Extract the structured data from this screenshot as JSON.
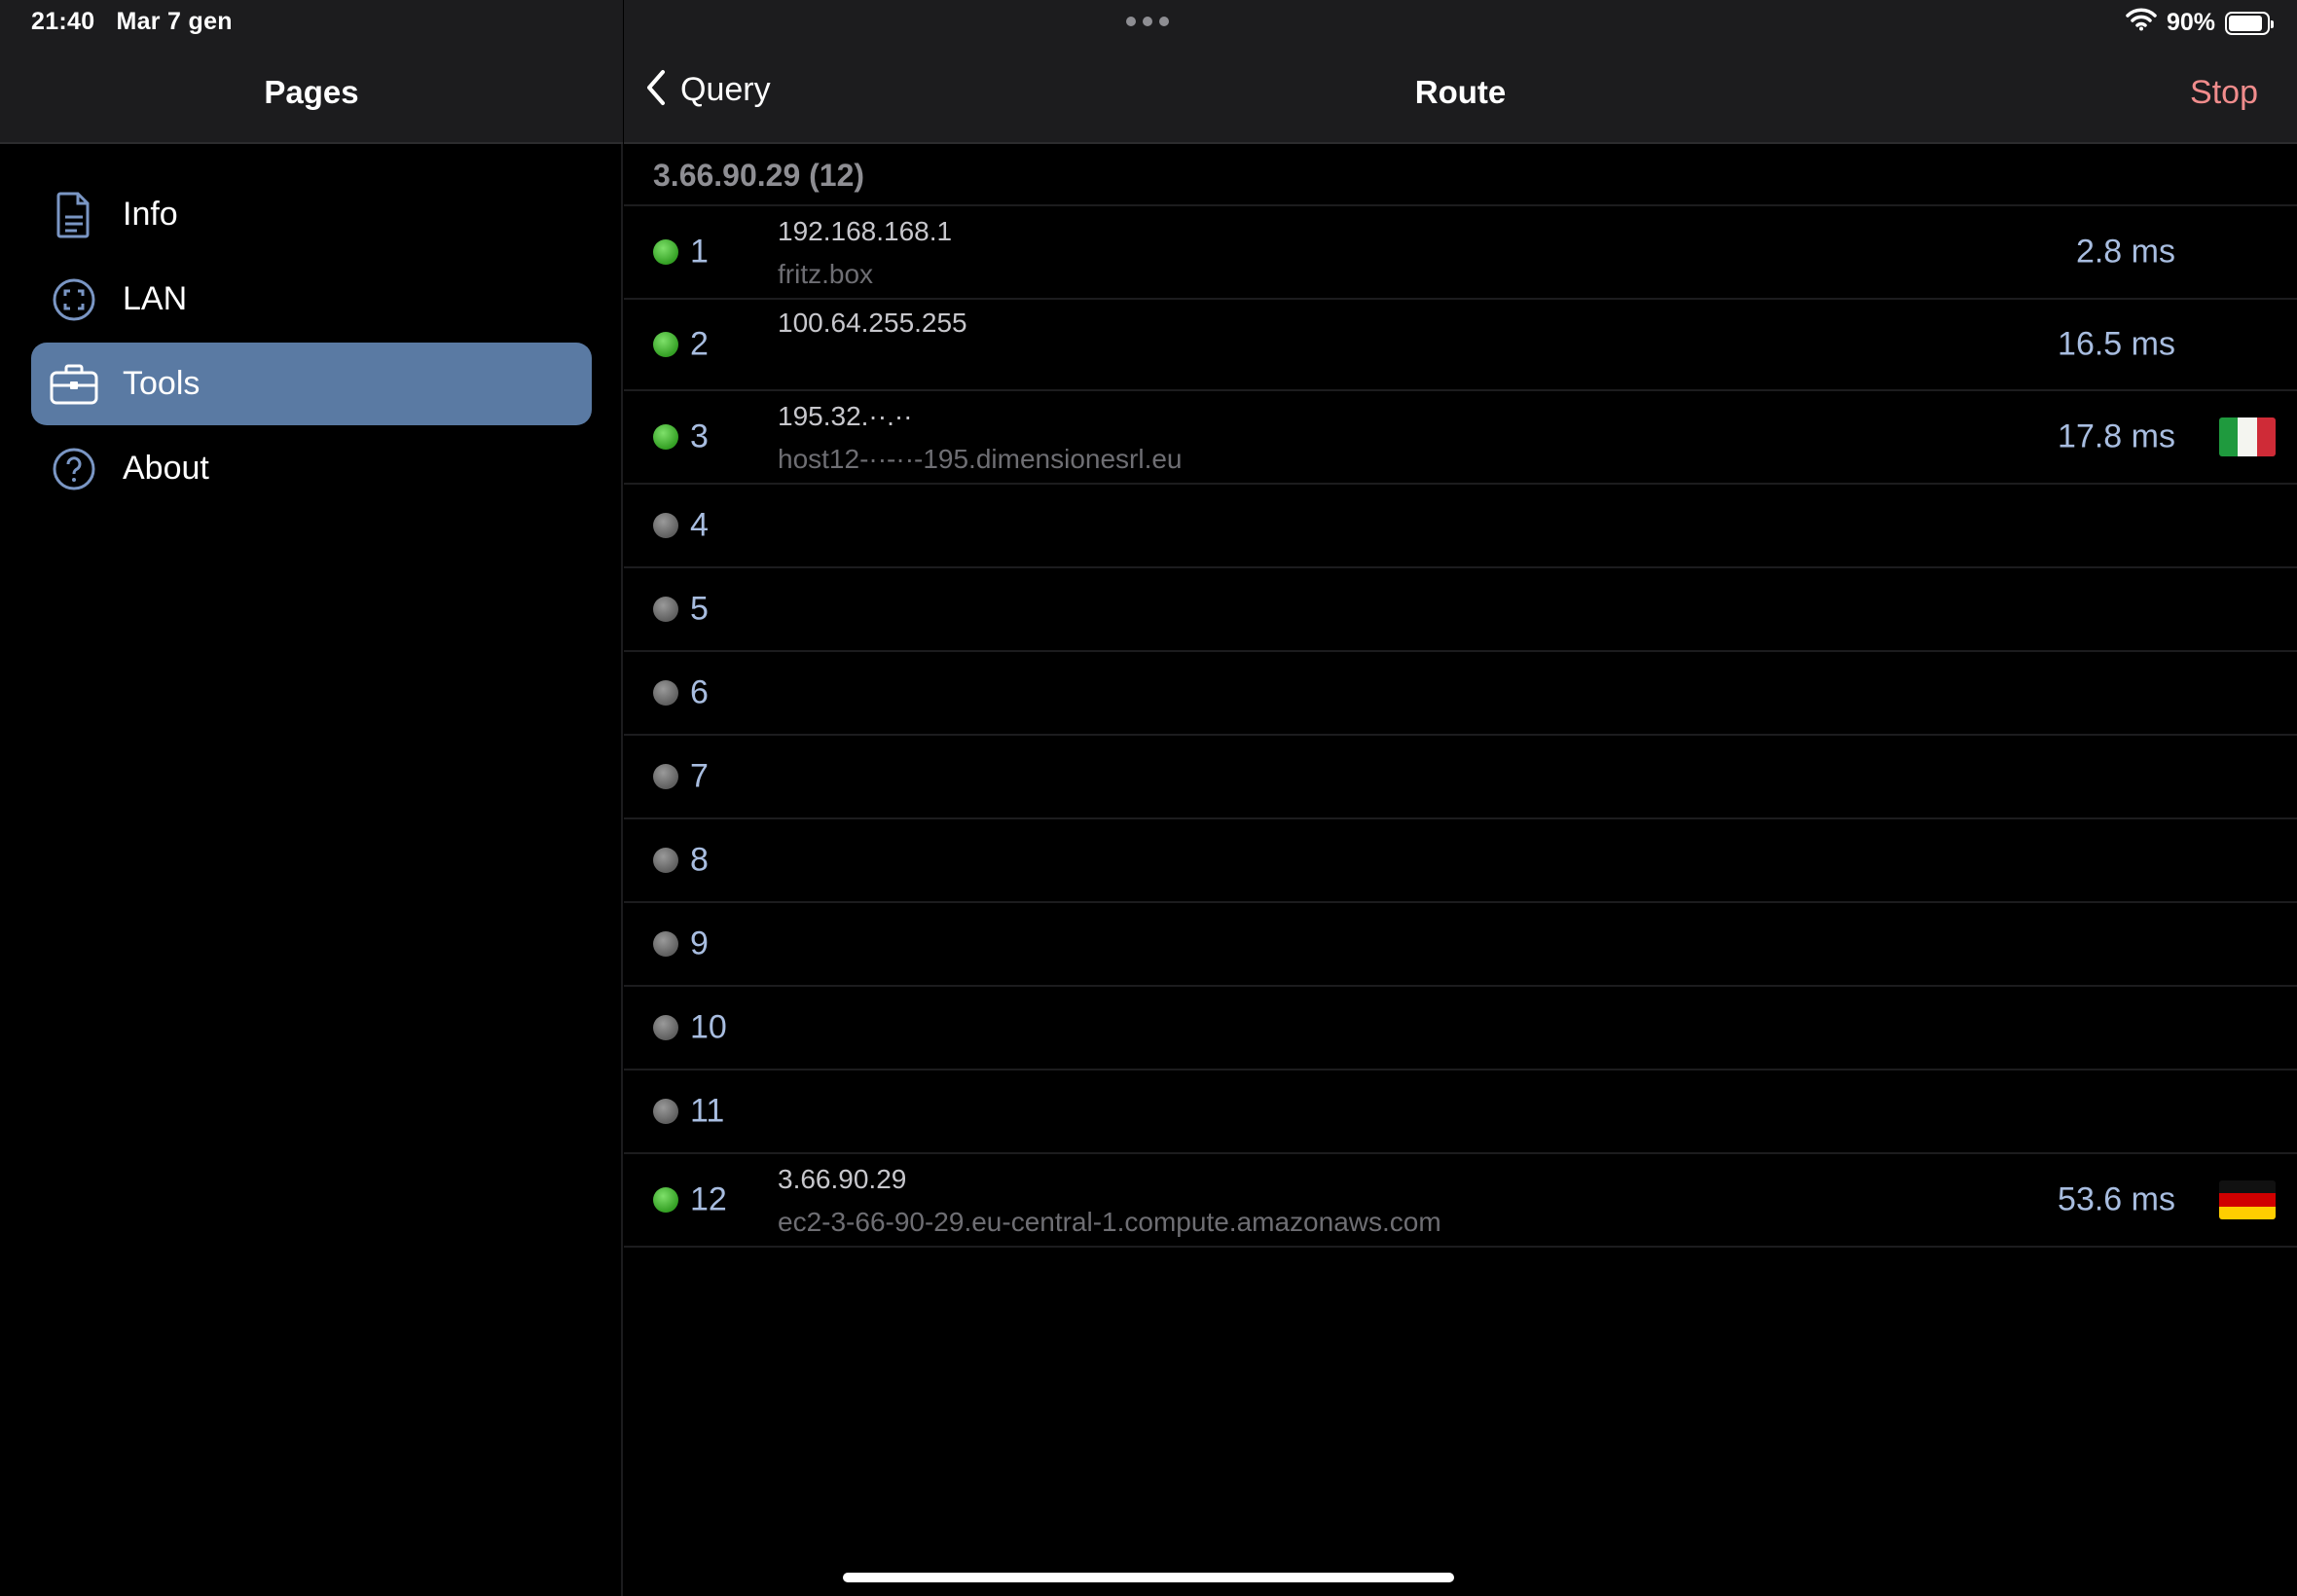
{
  "status_bar": {
    "time": "21:40",
    "date": "Mar 7 gen",
    "battery": "90%",
    "battery_level": 0.9
  },
  "sidebar": {
    "title": "Pages",
    "items": [
      {
        "label": "Info",
        "icon": "document-icon"
      },
      {
        "label": "LAN",
        "icon": "lan-icon"
      },
      {
        "label": "Tools",
        "icon": "briefcase-icon",
        "active": true
      },
      {
        "label": "About",
        "icon": "question-icon"
      }
    ]
  },
  "header": {
    "back_label": "Query",
    "title": "Route",
    "stop_label": "Stop"
  },
  "target": "3.66.90.29 (12)",
  "colors": {
    "accent_active": "#5a7aa3",
    "stop": "#f08c8c",
    "ok_dot": "#34a024",
    "timeout_dot": "#5f5f5f",
    "value_text": "#a8bde0"
  },
  "hops": [
    {
      "num": "1",
      "ip": "192.168.168.1",
      "host": "fritz.box",
      "time": "2.8 ms",
      "status": "ok",
      "flag": ""
    },
    {
      "num": "2",
      "ip": "100.64.255.255",
      "host": "",
      "time": "16.5 ms",
      "status": "ok",
      "flag": ""
    },
    {
      "num": "3",
      "ip": "195.32.··.··",
      "host": "host12-··-··-195.dimensionesrl.eu",
      "time": "17.8 ms",
      "status": "ok",
      "flag": "it"
    },
    {
      "num": "4",
      "ip": "",
      "host": "",
      "time": "",
      "status": "none",
      "flag": ""
    },
    {
      "num": "5",
      "ip": "",
      "host": "",
      "time": "",
      "status": "none",
      "flag": ""
    },
    {
      "num": "6",
      "ip": "",
      "host": "",
      "time": "",
      "status": "none",
      "flag": ""
    },
    {
      "num": "7",
      "ip": "",
      "host": "",
      "time": "",
      "status": "none",
      "flag": ""
    },
    {
      "num": "8",
      "ip": "",
      "host": "",
      "time": "",
      "status": "none",
      "flag": ""
    },
    {
      "num": "9",
      "ip": "",
      "host": "",
      "time": "",
      "status": "none",
      "flag": ""
    },
    {
      "num": "10",
      "ip": "",
      "host": "",
      "time": "",
      "status": "none",
      "flag": ""
    },
    {
      "num": "11",
      "ip": "",
      "host": "",
      "time": "",
      "status": "none",
      "flag": ""
    },
    {
      "num": "12",
      "ip": "3.66.90.29",
      "host": "ec2-3-66-90-29.eu-central-1.compute.amazonaws.com",
      "time": "53.6 ms",
      "status": "ok",
      "flag": "de"
    }
  ]
}
